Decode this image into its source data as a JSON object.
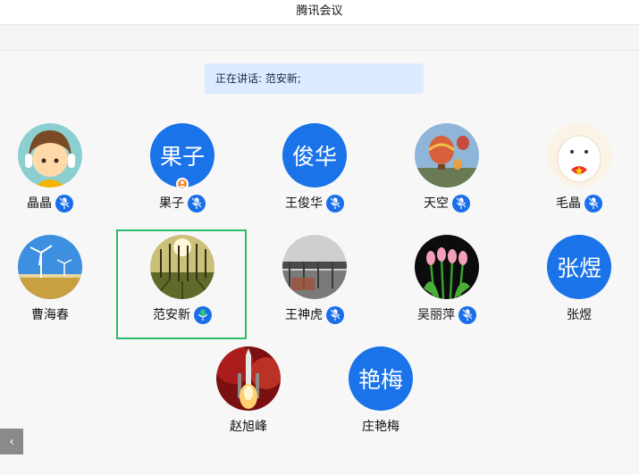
{
  "window": {
    "title": "腾讯会议"
  },
  "speaking": {
    "label": "正在讲话: 范安新;"
  },
  "participants": [
    {
      "name": "晶晶",
      "avatar_type": "photo",
      "avatar_desc": "cartoon-girl",
      "mic": "muted"
    },
    {
      "name": "果子",
      "avatar_type": "text",
      "avatar_text": "果子",
      "mic": "muted",
      "host": true
    },
    {
      "name": "王俊华",
      "avatar_type": "text",
      "avatar_text": "俊华",
      "mic": "muted"
    },
    {
      "name": "天空",
      "avatar_type": "photo",
      "avatar_desc": "hot-air-balloons",
      "mic": "muted"
    },
    {
      "name": "毛晶",
      "avatar_type": "photo",
      "avatar_desc": "seal-with-heart",
      "mic": "muted"
    },
    {
      "name": "曹海春",
      "avatar_type": "photo",
      "avatar_desc": "wind-turbines",
      "mic": "none"
    },
    {
      "name": "范安新",
      "avatar_type": "photo",
      "avatar_desc": "sunlit-trees",
      "mic": "speaking"
    },
    {
      "name": "王神虎",
      "avatar_type": "photo",
      "avatar_desc": "bridge-fog",
      "mic": "muted"
    },
    {
      "name": "吴丽萍",
      "avatar_type": "photo",
      "avatar_desc": "pink-tulips",
      "mic": "muted"
    },
    {
      "name": "张煜",
      "avatar_type": "text",
      "avatar_text": "张煜",
      "mic": "none"
    },
    {
      "name": "赵旭峰",
      "avatar_type": "photo",
      "avatar_desc": "rocket-launch",
      "mic": "none"
    },
    {
      "name": "庄艳梅",
      "avatar_type": "text",
      "avatar_text": "艳梅",
      "mic": "none"
    }
  ],
  "colors": {
    "accent": "#1a6fe8",
    "speaking_frame": "#2bbb6a",
    "banner": "#dcebff",
    "mic_active": "#2bd06a"
  },
  "back_button": {
    "icon": "chevron-left-icon",
    "label": "‹"
  }
}
